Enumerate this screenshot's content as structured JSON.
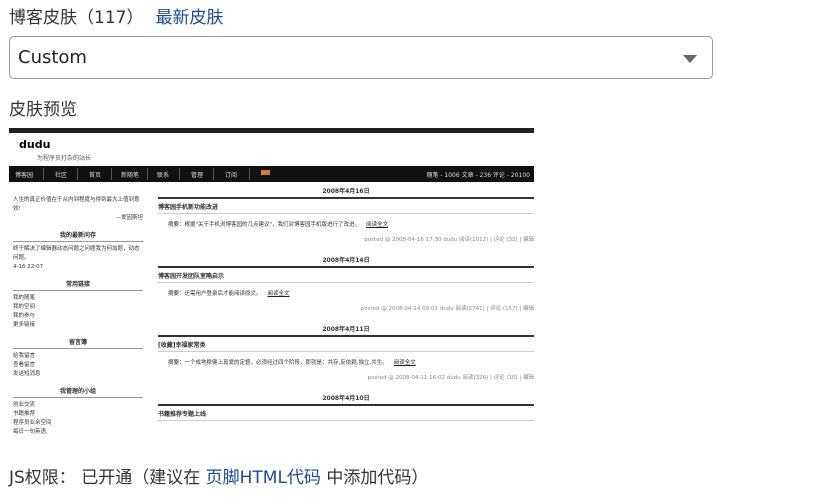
{
  "header": {
    "title": "博客皮肤（117）",
    "latest_link": "最新皮肤"
  },
  "skin_select": {
    "value": "Custom"
  },
  "preview": {
    "label": "皮肤预览",
    "blog_name": "dudu",
    "slogan": "为程序员打杂的站长",
    "nav": [
      "博客园",
      "社区",
      "首页",
      "新随笔",
      "联系",
      "管理",
      "订阅"
    ],
    "stats": "随笔 - 1006 文章 - 236 评论 - 20100",
    "sidebar": {
      "quote": "人生的真正价值在于从内到程度与得到最大上值到意效!",
      "quote_author": "—爱因斯坦",
      "recent_head": "我的最新问存",
      "recent_text": "终于解决了编辑器动态问题之问题我为何加题，动态问题。",
      "recent_time": "4-16 22:07",
      "common_head": "常用链接",
      "common_links": [
        "我的随笔",
        "我的空间",
        "我的参与",
        "更多链接"
      ],
      "msg_head": "留言簿",
      "msg_links": [
        "给我留言",
        "查看留言",
        "发送短消息"
      ],
      "group_head": "我管理的小组",
      "group_links": [
        "创业交流",
        "书籍推荐",
        "程序员业余空间",
        "每日一句英语"
      ]
    },
    "posts": [
      {
        "date": "2008年4月16日",
        "title": "博客园手机新功能改进",
        "abstract": "摘要：根据\"关于手机浏博客园的几点建议\"，我们对博客园手机版进行了改进。",
        "more": "阅读全文",
        "footer": "posted @ 2008-04-16 17:30 dudu 阅读(1012) | 评论 (32) | 编辑"
      },
      {
        "date": "2008年4月14日",
        "title": "博客园开发团队室略启示",
        "abstract": "摘要：还需用户登录后才能阅读原文。",
        "more": "阅读全文",
        "footer": "posted @ 2008-04-14 09:01 dudu 阅读(2741) | 评论 (157) | 编辑"
      },
      {
        "date": "2008年4月11日",
        "title": "[收藏]幸福家常类",
        "abstract": "摘要：一个成熟稳健上真爱的定督，必须经过四个阶段，那就是：共存,反依赖,独立,共生。",
        "more": "阅读全文",
        "footer": "posted @ 2008-04-11 16:02 dudu 阅读(326) | 评论 (10) | 编辑"
      },
      {
        "date": "2008年4月10日",
        "title": "书籍推荐专题上线",
        "abstract": "",
        "more": "",
        "footer": ""
      }
    ]
  },
  "js": {
    "label": "JS权限：",
    "status": "已开通（建议在",
    "link": "页脚HTML代码",
    "suffix": "中添加代码）"
  }
}
